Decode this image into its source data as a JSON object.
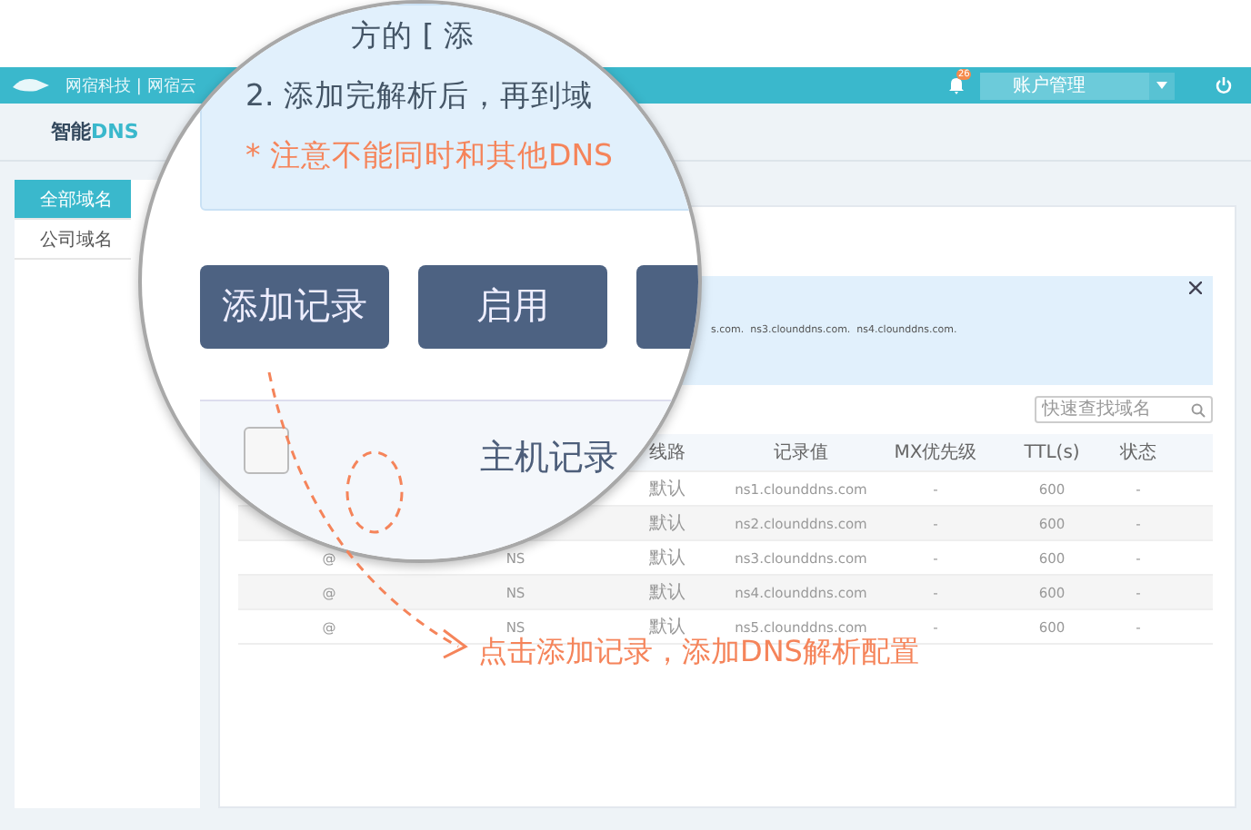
{
  "header": {
    "logo_text": "网宿科技 | 网宿云",
    "notification_count": "26",
    "account_menu": "账户管理"
  },
  "section_title": {
    "text": "智能",
    "accent": "DNS"
  },
  "sidebar": {
    "items": [
      {
        "label": "全部域名",
        "selected": true
      },
      {
        "label": "公司域名",
        "selected": false
      }
    ]
  },
  "info_box": {
    "text": "s.com.  ns3.clounddns.com.  ns4.clounddns.com."
  },
  "search": {
    "placeholder": "快速查找域名"
  },
  "table": {
    "columns": [
      "线路",
      "记录值",
      "MX优先级",
      "TTL(s)",
      "状态"
    ],
    "rows": [
      {
        "line": "默认",
        "value": "ns1.clounddns.com",
        "mx": "-",
        "ttl": "600",
        "status": "-"
      },
      {
        "line": "默认",
        "value": "ns2.clounddns.com",
        "mx": "-",
        "ttl": "600",
        "status": "-"
      },
      {
        "host": "@",
        "type": "NS",
        "line": "默认",
        "value": "ns3.clounddns.com",
        "mx": "-",
        "ttl": "600",
        "status": "-"
      },
      {
        "host": "@",
        "type": "NS",
        "line": "默认",
        "value": "ns4.clounddns.com",
        "mx": "-",
        "ttl": "600",
        "status": "-"
      },
      {
        "host": "@",
        "type": "NS",
        "line": "默认",
        "value": "ns5.clounddns.com",
        "mx": "-",
        "ttl": "600",
        "status": "-"
      }
    ]
  },
  "magnifier": {
    "lines": [
      {
        "text": "方的 [ 添",
        "kind": "normal"
      },
      {
        "text": "2. 添加完解析后，再到域",
        "kind": "normal"
      },
      {
        "text": "*  注意不能同时和其他DNS",
        "kind": "warning"
      }
    ],
    "buttons": [
      "添加记录",
      "启用"
    ],
    "checkbox_checked": false,
    "table_header": "主机记录"
  },
  "annotation": "点击添加记录，添加DNS解析配置"
}
